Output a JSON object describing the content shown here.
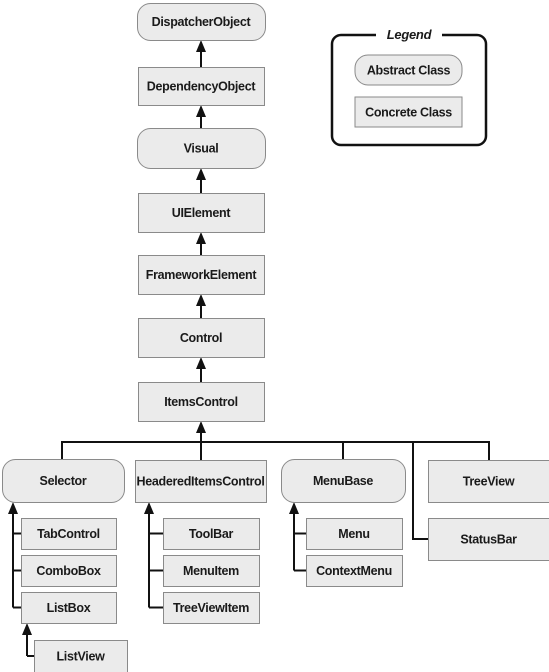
{
  "colors": {
    "box_fill": "#ebebeb",
    "box_stroke": "#8a8a8a",
    "line": "#111111"
  },
  "legend": {
    "title": "Legend",
    "abstract_label": "Abstract Class",
    "concrete_label": "Concrete Class"
  },
  "nodes": [
    {
      "id": "dispatcherobject",
      "label": "DispatcherObject",
      "kind": "abstract"
    },
    {
      "id": "dependencyobject",
      "label": "DependencyObject",
      "kind": "concrete"
    },
    {
      "id": "visual",
      "label": "Visual",
      "kind": "abstract"
    },
    {
      "id": "uielement",
      "label": "UIElement",
      "kind": "concrete"
    },
    {
      "id": "frameworkelement",
      "label": "FrameworkElement",
      "kind": "concrete"
    },
    {
      "id": "control",
      "label": "Control",
      "kind": "concrete"
    },
    {
      "id": "itemscontrol",
      "label": "ItemsControl",
      "kind": "concrete"
    },
    {
      "id": "selector",
      "label": "Selector",
      "kind": "abstract"
    },
    {
      "id": "headereditemscontrol",
      "label": "HeaderedItemsControl",
      "kind": "concrete"
    },
    {
      "id": "menubase",
      "label": "MenuBase",
      "kind": "abstract"
    },
    {
      "id": "treeview",
      "label": "TreeView",
      "kind": "concrete"
    },
    {
      "id": "statusbar",
      "label": "StatusBar",
      "kind": "concrete"
    },
    {
      "id": "tabcontrol",
      "label": "TabControl",
      "kind": "concrete"
    },
    {
      "id": "combobox",
      "label": "ComboBox",
      "kind": "concrete"
    },
    {
      "id": "listbox",
      "label": "ListBox",
      "kind": "concrete"
    },
    {
      "id": "listview",
      "label": "ListView",
      "kind": "concrete"
    },
    {
      "id": "toolbar",
      "label": "ToolBar",
      "kind": "concrete"
    },
    {
      "id": "menuitem",
      "label": "MenuItem",
      "kind": "concrete"
    },
    {
      "id": "treeviewitem",
      "label": "TreeViewItem",
      "kind": "concrete"
    },
    {
      "id": "menu",
      "label": "Menu",
      "kind": "concrete"
    },
    {
      "id": "contextmenu",
      "label": "ContextMenu",
      "kind": "concrete"
    }
  ],
  "inheritance": [
    [
      "dependencyobject",
      "dispatcherobject"
    ],
    [
      "visual",
      "dependencyobject"
    ],
    [
      "uielement",
      "visual"
    ],
    [
      "frameworkelement",
      "uielement"
    ],
    [
      "control",
      "frameworkelement"
    ],
    [
      "itemscontrol",
      "control"
    ],
    [
      "selector",
      "itemscontrol"
    ],
    [
      "headereditemscontrol",
      "itemscontrol"
    ],
    [
      "menubase",
      "itemscontrol"
    ],
    [
      "treeview",
      "itemscontrol"
    ],
    [
      "statusbar",
      "itemscontrol"
    ],
    [
      "tabcontrol",
      "selector"
    ],
    [
      "combobox",
      "selector"
    ],
    [
      "listbox",
      "selector"
    ],
    [
      "listview",
      "listbox"
    ],
    [
      "toolbar",
      "headereditemscontrol"
    ],
    [
      "menuitem",
      "headereditemscontrol"
    ],
    [
      "treeviewitem",
      "headereditemscontrol"
    ],
    [
      "menu",
      "menubase"
    ],
    [
      "contextmenu",
      "menubase"
    ]
  ]
}
